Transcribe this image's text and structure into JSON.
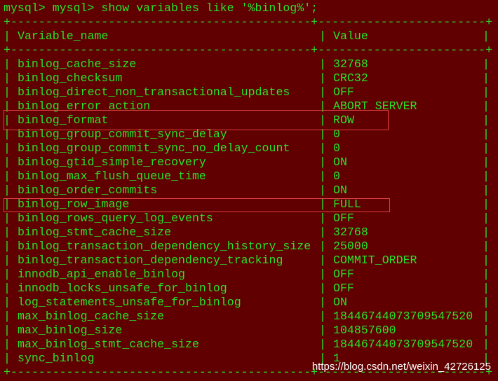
{
  "prompt": "mysql> mysql> show variables like '%binlog%';",
  "border_top": "+-------------------------------------------+------------------------+",
  "border_header": "+-------------------------------------------+------------------------+",
  "border_bottom": "+-------------------------------------------+------------------------+",
  "header": {
    "name": "Variable_name",
    "value": "Value"
  },
  "rows": [
    {
      "name": "binlog_cache_size",
      "value": "32768"
    },
    {
      "name": "binlog_checksum",
      "value": "CRC32"
    },
    {
      "name": "binlog_direct_non_transactional_updates",
      "value": "OFF"
    },
    {
      "name": "binlog_error_action",
      "value": "ABORT_SERVER"
    },
    {
      "name": "binlog_format",
      "value": "ROW"
    },
    {
      "name": "binlog_group_commit_sync_delay",
      "value": "0"
    },
    {
      "name": "binlog_group_commit_sync_no_delay_count",
      "value": "0"
    },
    {
      "name": "binlog_gtid_simple_recovery",
      "value": "ON"
    },
    {
      "name": "binlog_max_flush_queue_time",
      "value": "0"
    },
    {
      "name": "binlog_order_commits",
      "value": "ON"
    },
    {
      "name": "binlog_row_image",
      "value": "FULL"
    },
    {
      "name": "binlog_rows_query_log_events",
      "value": "OFF"
    },
    {
      "name": "binlog_stmt_cache_size",
      "value": "32768"
    },
    {
      "name": "binlog_transaction_dependency_history_size",
      "value": "25000"
    },
    {
      "name": "binlog_transaction_dependency_tracking",
      "value": "COMMIT_ORDER"
    },
    {
      "name": "innodb_api_enable_binlog",
      "value": "OFF"
    },
    {
      "name": "innodb_locks_unsafe_for_binlog",
      "value": "OFF"
    },
    {
      "name": "log_statements_unsafe_for_binlog",
      "value": "ON"
    },
    {
      "name": "max_binlog_cache_size",
      "value": "18446744073709547520"
    },
    {
      "name": "max_binlog_size",
      "value": "104857600"
    },
    {
      "name": "max_binlog_stmt_cache_size",
      "value": "18446744073709547520"
    },
    {
      "name": "sync_binlog",
      "value": "1"
    }
  ],
  "pipe": "|",
  "watermark": "https://blog.csdn.net/weixin_42726125",
  "colors": {
    "background": "#600000",
    "text": "#2be02b",
    "highlight": "#e04040",
    "watermark": "#ffffff"
  }
}
